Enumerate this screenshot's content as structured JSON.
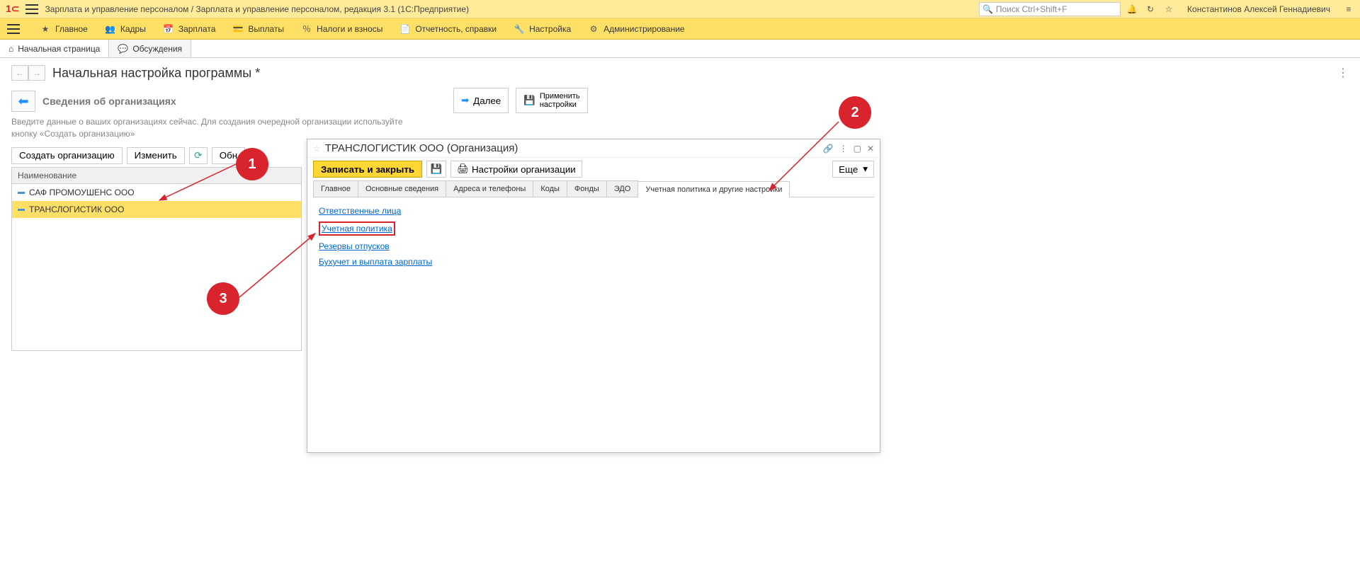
{
  "titlebar": {
    "app_title": "Зарплата и управление персоналом / Зарплата и управление персоналом, редакция 3.1  (1С:Предприятие)",
    "search_placeholder": "Поиск Ctrl+Shift+F",
    "username": "Константинов Алексей Геннадиевич"
  },
  "main_toolbar": {
    "items": [
      "Главное",
      "Кадры",
      "Зарплата",
      "Выплаты",
      "Налоги и взносы",
      "Отчетность, справки",
      "Настройка",
      "Администрирование"
    ]
  },
  "bottom_tabs": {
    "home": "Начальная страница",
    "discussions": "Обсуждения"
  },
  "page": {
    "title": "Начальная настройка программы *",
    "section_title": "Сведения об организациях",
    "hint": "Введите данные о ваших организациях сейчас. Для создания очередной организации используйте кнопку «Создать организацию»",
    "next_btn": "Далее",
    "apply_btn_line1": "Применить",
    "apply_btn_line2": "настройки"
  },
  "local_toolbar": {
    "create": "Создать организацию",
    "edit": "Изменить",
    "refresh": "Обн"
  },
  "list": {
    "header": "Наименование",
    "rows": [
      "САФ ПРОМОУШЕНС ООО",
      "ТРАНСЛОГИСТИК ООО"
    ]
  },
  "dialog": {
    "title": "ТРАНСЛОГИСТИК ООО (Организация)",
    "save_close": "Записать и закрыть",
    "org_settings": "Настройки организации",
    "more": "Еще",
    "tabs": [
      "Главное",
      "Основные сведения",
      "Адреса и телефоны",
      "Коды",
      "Фонды",
      "ЭДО",
      "Учетная политика и другие настройки"
    ],
    "links": [
      "Ответственные лица",
      "Учетная политика",
      "Резервы отпусков",
      "Бухучет и выплата зарплаты"
    ]
  },
  "annotations": {
    "1": "1",
    "2": "2",
    "3": "3"
  }
}
